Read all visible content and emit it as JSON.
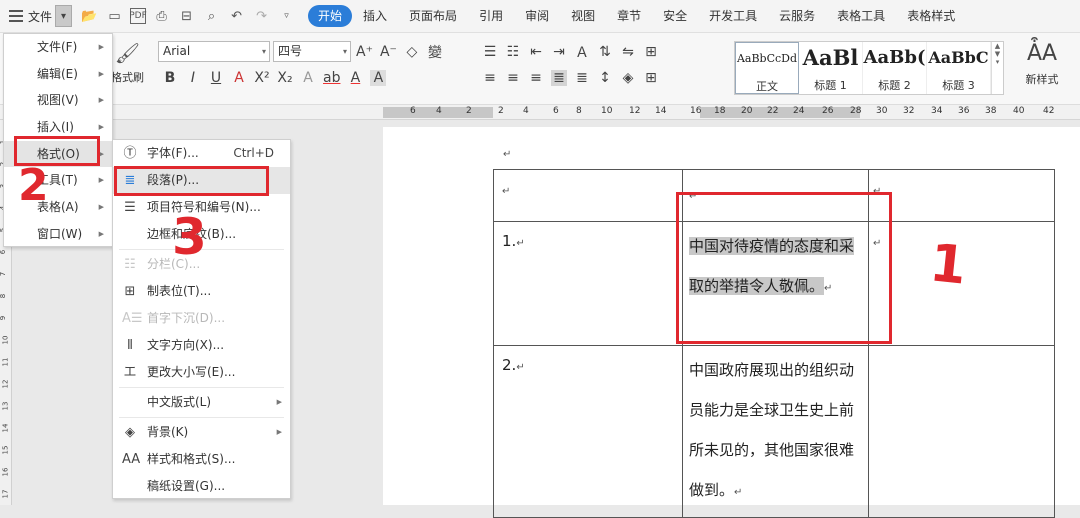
{
  "menubar": {
    "file_label": "文件",
    "tabs": [
      {
        "label": "开始",
        "active": true
      },
      {
        "label": "插入"
      },
      {
        "label": "页面布局"
      },
      {
        "label": "引用"
      },
      {
        "label": "审阅"
      },
      {
        "label": "视图"
      },
      {
        "label": "章节"
      },
      {
        "label": "安全"
      },
      {
        "label": "开发工具"
      },
      {
        "label": "云服务"
      },
      {
        "label": "表格工具"
      },
      {
        "label": "表格样式"
      }
    ],
    "quick_icons": [
      "open-icon",
      "save-icon",
      "pdf-icon",
      "print-icon",
      "print-preview-icon",
      "zoom-icon",
      "undo-icon",
      "redo-icon",
      "more-icon"
    ]
  },
  "ribbon": {
    "painter_label": "格式刷",
    "font_name": "Arial",
    "font_size": "四号",
    "styles": [
      {
        "preview": "AaBbCcDd",
        "name": "正文"
      },
      {
        "preview": "AaBl",
        "name": "标题 1"
      },
      {
        "preview": "AaBb(",
        "name": "标题 2"
      },
      {
        "preview": "AaBbC",
        "name": "标题 3"
      }
    ],
    "new_style_label": "新样式"
  },
  "ruler": {
    "numbers": [
      "6",
      "4",
      "2",
      "2",
      "4",
      "6",
      "8",
      "10",
      "12",
      "14",
      "16",
      "18",
      "20",
      "22",
      "24",
      "26",
      "28",
      "30",
      "32",
      "34",
      "36",
      "38",
      "40",
      "42"
    ]
  },
  "vruler": {
    "numbers": [
      "1",
      "2",
      "3",
      "4",
      "5",
      "6",
      "7",
      "8",
      "9",
      "10",
      "11",
      "12",
      "13",
      "14",
      "15",
      "16",
      "17"
    ]
  },
  "menu": {
    "items": [
      {
        "label": "文件(F)"
      },
      {
        "label": "编辑(E)"
      },
      {
        "label": "视图(V)"
      },
      {
        "label": "插入(I)"
      },
      {
        "label": "格式(O)",
        "active": true
      },
      {
        "label": "工具(T)"
      },
      {
        "label": "表格(A)"
      },
      {
        "label": "窗口(W)"
      }
    ]
  },
  "submenu": {
    "font": {
      "label": "字体(F)...",
      "shortcut": "Ctrl+D"
    },
    "paragraph": {
      "label": "段落(P)..."
    },
    "bullets": {
      "label": "项目符号和编号(N)..."
    },
    "borders": {
      "label": "边框和底纹(B)..."
    },
    "columns": {
      "label": "分栏(C)..."
    },
    "tabs": {
      "label": "制表位(T)..."
    },
    "dropcap": {
      "label": "首字下沉(D)..."
    },
    "text_direction": {
      "label": "文字方向(X)..."
    },
    "change_case": {
      "label": "更改大小写(E)..."
    },
    "chinese_layout": {
      "label": "中文版式(L)"
    },
    "background": {
      "label": "背景(K)"
    },
    "styles_formatting": {
      "label": "样式和格式(S)..."
    },
    "page_setup": {
      "label": "稿纸设置(G)..."
    }
  },
  "document": {
    "para_mark": "↵",
    "row1": {
      "c1": "1.",
      "c2": "中国对待疫情的态度和采取的举措令人敬佩。"
    },
    "row2": {
      "c1": "2.",
      "c2": "中国政府展现出的组织动员能力是全球卫生史上前所未见的，其他国家很难做到。"
    }
  },
  "annotations": {
    "one": "1",
    "two": "2",
    "three": "3"
  },
  "colors": {
    "accent": "#2b7dd8",
    "annotation": "#e0282e",
    "selection": "#c8c8c8"
  }
}
